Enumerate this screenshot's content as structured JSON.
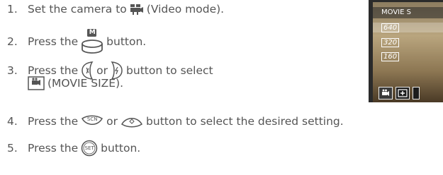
{
  "steps": [
    {
      "num": "1.",
      "a": "Set the camera to",
      "b": "(Video mode)."
    },
    {
      "num": "2.",
      "a": "Press the",
      "b": "button.",
      "icon_label": "M"
    },
    {
      "num": "3.",
      "a": "Press the",
      "or": "or",
      "b": "button to select",
      "c": "(MOVIE SIZE)."
    },
    {
      "num": "4.",
      "a": "Press the",
      "or": "or",
      "b": "button to select the desired setting.",
      "icon1_label": "SCN"
    },
    {
      "num": "5.",
      "a": "Press the",
      "b": "button.",
      "icon_label": "SET"
    }
  ],
  "lcd": {
    "title": "MOVIE S",
    "options": [
      "640",
      "320",
      "160"
    ]
  },
  "colors": {
    "text": "#555555",
    "icon": "#555555"
  }
}
